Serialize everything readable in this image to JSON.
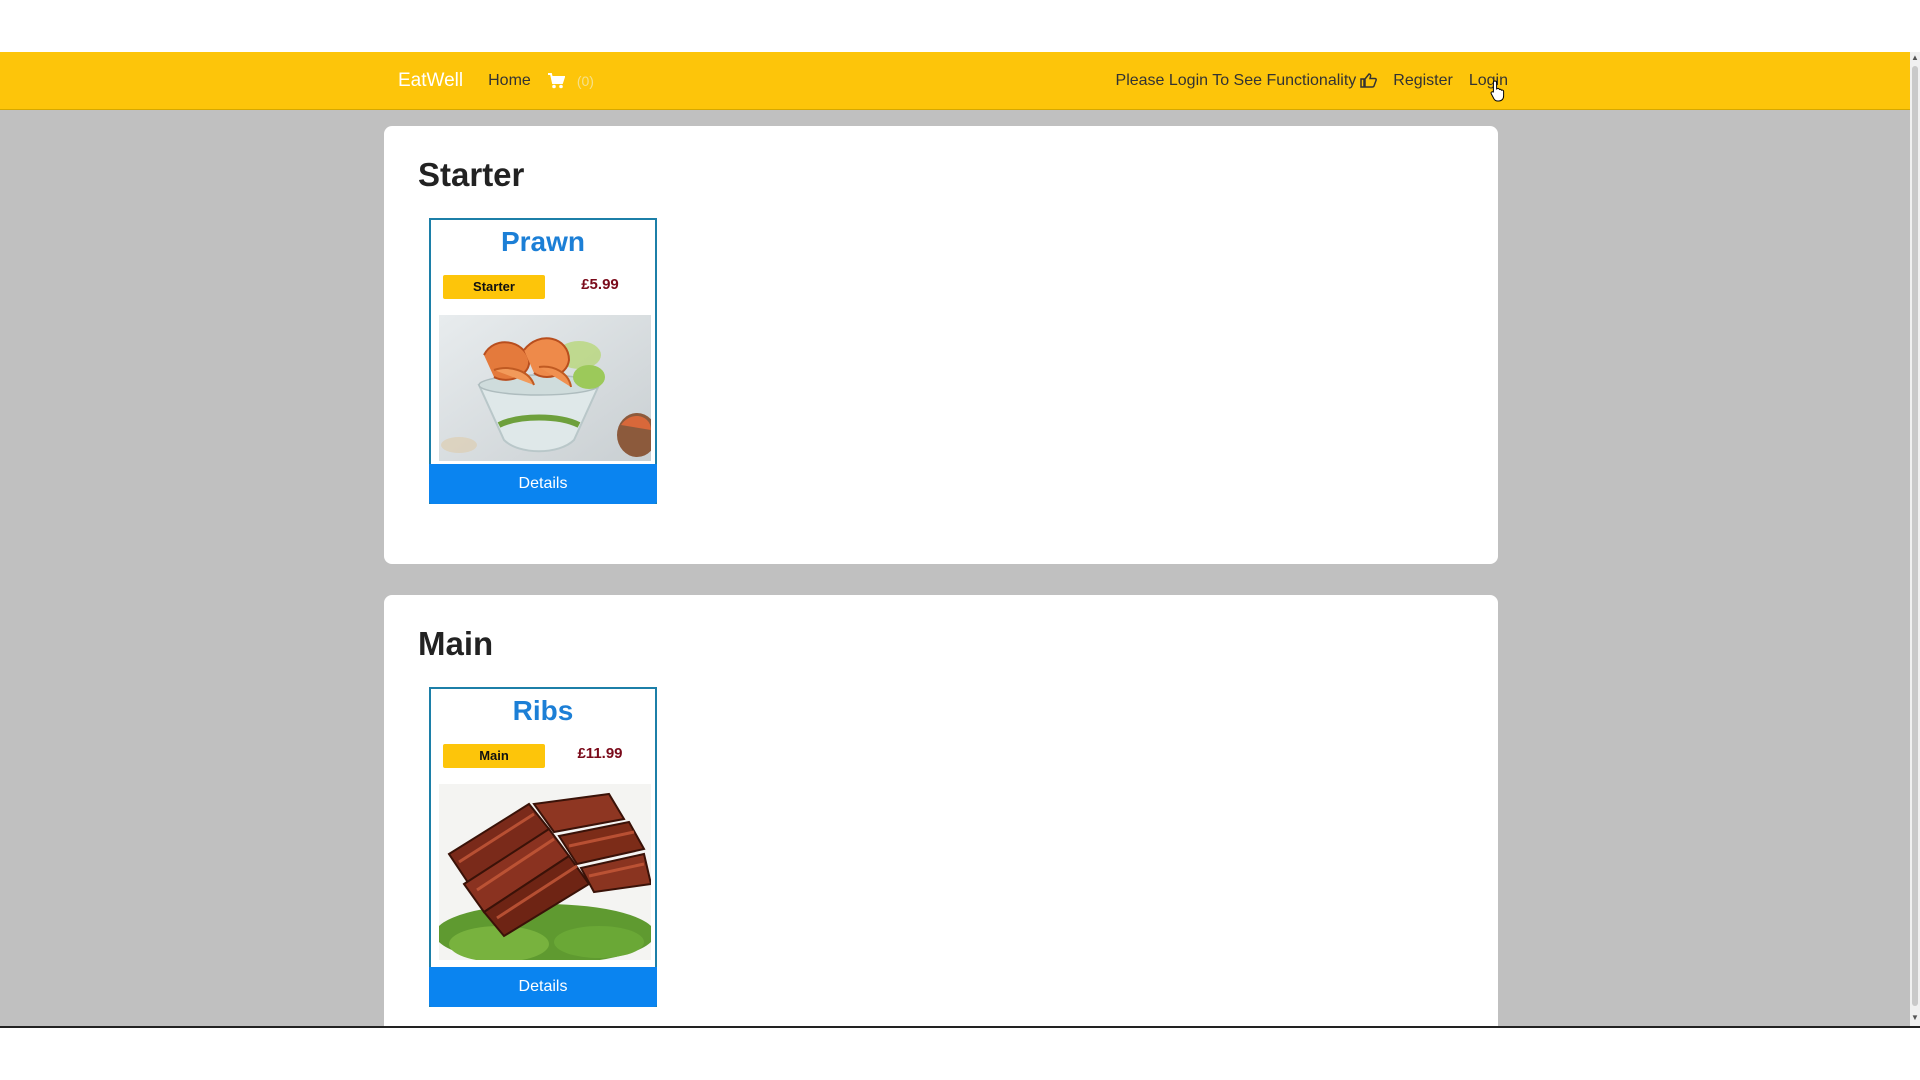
{
  "nav": {
    "brand": "EatWell",
    "home": "Home",
    "cart_count": "(0)",
    "login_hint": "Please Login To See Functionality",
    "register": "Register",
    "login": "Login"
  },
  "sections": [
    {
      "title": "Starter",
      "item": {
        "name": "Prawn",
        "category": "Starter",
        "price": "£5.99",
        "button": "Details"
      }
    },
    {
      "title": "Main",
      "item": {
        "name": "Ribs",
        "category": "Main",
        "price": "£11.99",
        "button": "Details"
      }
    }
  ],
  "icons": {
    "cart": "cart-icon",
    "hint": "thumbs-up-icon"
  },
  "colors": {
    "navbar": "#fdc50a",
    "primary": "#0a84f0",
    "item_name": "#1c7fd6",
    "price": "#7a0a1a",
    "background": "#c0c0c0"
  }
}
